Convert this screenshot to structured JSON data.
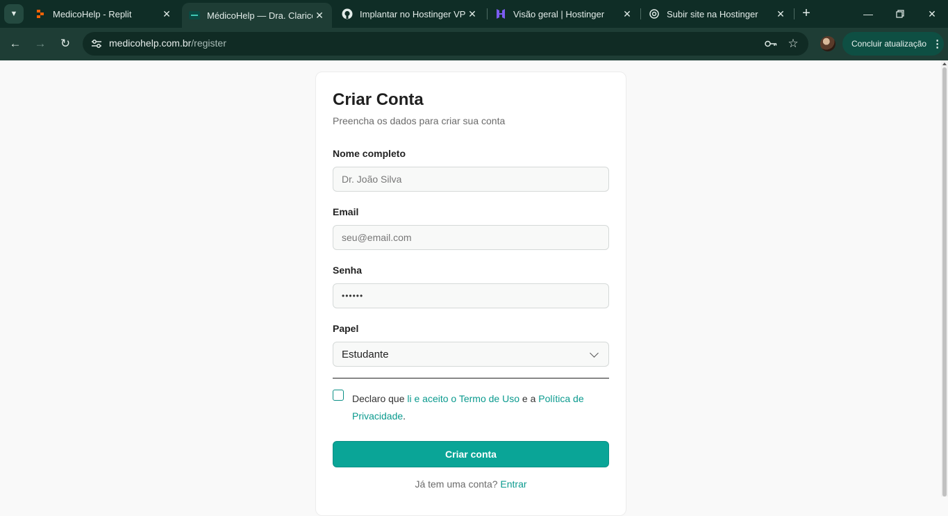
{
  "browser": {
    "tabs": [
      {
        "title": "MedicoHelp - Replit",
        "icon": "replit-icon",
        "active": false
      },
      {
        "title": "MédicoHelp — Dra. Clarice",
        "icon": "medicohelp-icon",
        "active": true
      },
      {
        "title": "Implantar no Hostinger VPS",
        "icon": "github-icon",
        "active": false
      },
      {
        "title": "Visão geral | Hostinger",
        "icon": "hostinger-icon",
        "active": false
      },
      {
        "title": "Subir site na Hostinger",
        "icon": "openai-icon",
        "active": false
      }
    ],
    "url_host": "medicohelp.com.br",
    "url_path": "/register",
    "update_button": "Concluir atualização",
    "accent": "#1e3d35"
  },
  "form": {
    "title": "Criar Conta",
    "subtitle": "Preencha os dados para criar sua conta",
    "name_label": "Nome completo",
    "name_placeholder": "Dr. João Silva",
    "email_label": "Email",
    "email_placeholder": "seu@email.com",
    "password_label": "Senha",
    "password_value": "••••••",
    "role_label": "Papel",
    "role_value": "Estudante",
    "terms_prefix": "Declaro que ",
    "terms_link1": "li e aceito o Termo de Uso",
    "terms_middle": " e a ",
    "terms_link2": "Política de Privacidade",
    "terms_suffix": ".",
    "submit_label": "Criar conta",
    "login_prompt": "Já tem uma conta? ",
    "login_link": "Entrar",
    "primary_color": "#0aa597"
  }
}
